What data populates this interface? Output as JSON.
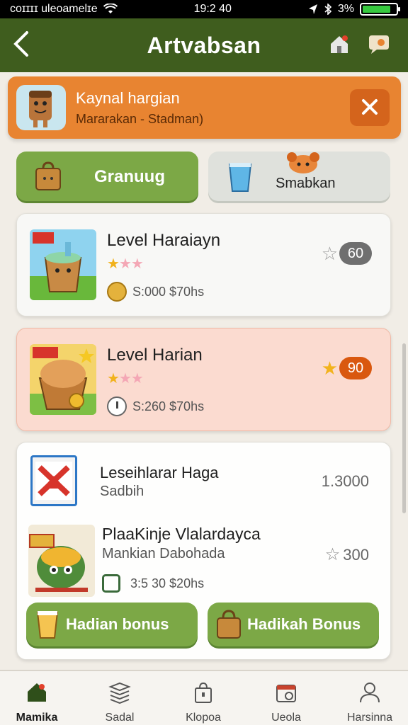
{
  "status_bar": {
    "carrier": "coɪɪɪɪ uleoamelɪe",
    "time": "19:2 40",
    "battery_text": "3%",
    "battery_level": 0.85
  },
  "header": {
    "title": "Artvabsan"
  },
  "banner": {
    "title": "Kaynal hargian",
    "subtitle": "Mararakan - Stadman)"
  },
  "pills": [
    {
      "label": "Granuug"
    },
    {
      "label": "Smabkan"
    }
  ],
  "cards": [
    {
      "title": "Level Haraiayn",
      "stars": 1,
      "meta": "S:000 $70hs",
      "badge": "60"
    },
    {
      "title": "Level Harian",
      "stars": 1,
      "meta": "S:260 $70hs",
      "badge": "90"
    }
  ],
  "combo": {
    "row1": {
      "title": "Leseihlarar Haga",
      "subtitle": "Sadbih",
      "value": "1.3000"
    },
    "row2": {
      "title": "PlaaKinje Vlalardayca",
      "subtitle": "Mankian Dabohada",
      "badge": "300",
      "meta": "3:5 30 $20hs"
    },
    "buttons": [
      {
        "label": "Hadian bonus"
      },
      {
        "label": "Hadikah Bonus"
      }
    ]
  },
  "tabs": [
    {
      "label": "Mamika",
      "icon": "home-icon",
      "active": true
    },
    {
      "label": "Sadal",
      "icon": "layers-icon",
      "active": false
    },
    {
      "label": "Klopoa",
      "icon": "bag-icon",
      "active": false
    },
    {
      "label": "Ueola",
      "icon": "calendar-icon",
      "active": false
    },
    {
      "label": "Harsinna",
      "icon": "user-icon",
      "active": false
    }
  ],
  "colors": {
    "header": "#3f5d1e",
    "banner": "#e88431",
    "accent_green": "#7ca846",
    "accent_orange": "#d9580f"
  }
}
